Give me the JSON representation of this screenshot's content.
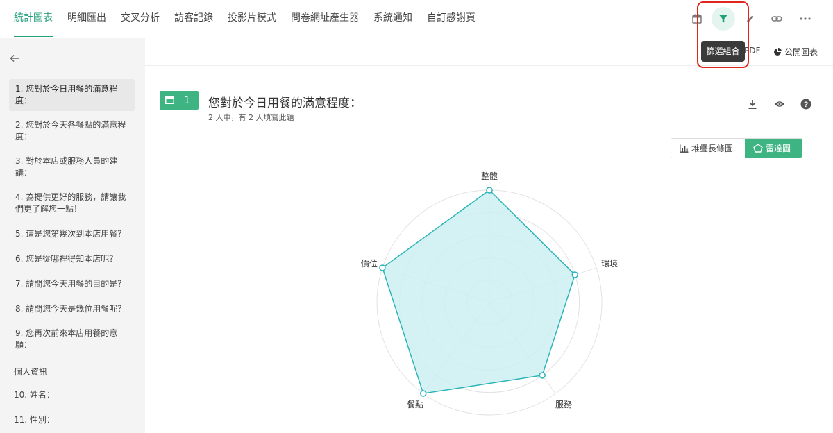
{
  "nav": {
    "tabs": [
      "統計圖表",
      "明細匯出",
      "交叉分析",
      "訪客記錄",
      "投影片模式",
      "問卷網址產生器",
      "系統通知",
      "自訂感謝頁"
    ],
    "active_tab": "統計圖表"
  },
  "toolbar": {
    "tools": [
      "calendar-icon",
      "filter-icon",
      "pencil-icon",
      "link-icon",
      "more-icon"
    ],
    "tooltip": "篩選組合",
    "accent": "#22a07a",
    "highlight_box_color": "#e0251f"
  },
  "subbar": {
    "pdf_label": "PDF",
    "public_label": "公開圖表"
  },
  "sidebar": {
    "back_icon": "arrow-left-icon",
    "questions": [
      "1. 您對於今日用餐的滿意程度：",
      "2. 您對於今天各餐點的滿意程度：",
      "3. 對於本店或服務人員的建議：",
      "4. 為提供更好的服務，請讓我們更了解您一點！",
      "5. 這是您第幾次到本店用餐？",
      "6. 您是從哪裡得知本店呢？",
      "7. 請問您今天用餐的目的是？",
      "8. 請問您今天是幾位用餐呢？",
      "9. 您再次前來本店用餐的意願："
    ],
    "section_title": "個人資訊",
    "personal": [
      "10. 姓名：",
      "11. 性別："
    ]
  },
  "question": {
    "number": "1",
    "title": "您對於今日用餐的滿意程度：",
    "subtitle": "2 人中，有 2 人填寫此題",
    "actions": [
      "download-icon",
      "eye-icon",
      "help-icon"
    ]
  },
  "chart_toggle": {
    "stacked_label": "堆疊長條圖",
    "radar_label": "雷達圖",
    "active": "雷達圖"
  },
  "chart_data": {
    "type": "radar",
    "axes": [
      "整體",
      "環境",
      "服務",
      "餐點",
      "價位"
    ],
    "values": [
      5,
      4,
      4,
      5,
      5
    ],
    "max": 5,
    "rings": 5,
    "line_color": "#2bb5b8",
    "fill_color": "#cdeef1"
  }
}
